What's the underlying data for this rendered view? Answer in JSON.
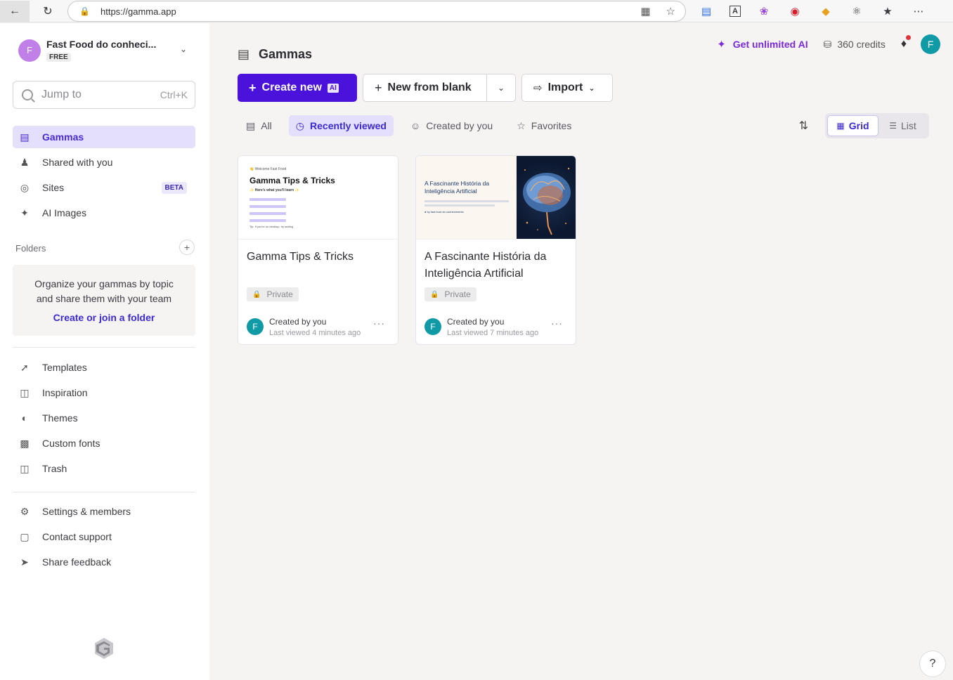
{
  "browser": {
    "url": "https://gamma.app"
  },
  "workspace": {
    "avatar_letter": "F",
    "name": "Fast Food do conheci...",
    "plan": "FREE"
  },
  "search": {
    "placeholder": "Jump to",
    "shortcut": "Ctrl+K"
  },
  "sidebar": {
    "nav": [
      {
        "label": "Gammas",
        "icon": "gammas-icon"
      },
      {
        "label": "Shared with you",
        "icon": "users-icon"
      },
      {
        "label": "Sites",
        "icon": "globe-icon",
        "badge": "BETA"
      },
      {
        "label": "AI Images",
        "icon": "sparkle-icon"
      }
    ],
    "folders_label": "Folders",
    "folders_description": "Organize your gammas by topic and share them with your team",
    "folders_link": "Create or join a folder",
    "secondary_nav": [
      {
        "label": "Templates",
        "icon": "bolt-icon"
      },
      {
        "label": "Inspiration",
        "icon": "book-icon"
      },
      {
        "label": "Themes",
        "icon": "palette-icon"
      },
      {
        "label": "Custom fonts",
        "icon": "font-icon"
      },
      {
        "label": "Trash",
        "icon": "trash-icon"
      }
    ],
    "footer_nav": [
      {
        "label": "Settings & members",
        "icon": "settings-icon"
      },
      {
        "label": "Contact support",
        "icon": "chat-icon"
      },
      {
        "label": "Share feedback",
        "icon": "send-icon"
      }
    ]
  },
  "header": {
    "page_title": "Gammas",
    "unlimited_ai": "Get unlimited AI",
    "credits": "360 credits",
    "user_avatar_letter": "F"
  },
  "actions": {
    "create_new": "Create new",
    "ai_tag": "AI",
    "new_from_blank": "New from blank",
    "import": "Import"
  },
  "filters": [
    {
      "label": "All",
      "icon": "stack-icon"
    },
    {
      "label": "Recently viewed",
      "icon": "clock-icon",
      "active": true
    },
    {
      "label": "Created by you",
      "icon": "user-circle-icon"
    },
    {
      "label": "Favorites",
      "icon": "star-icon"
    }
  ],
  "view": {
    "grid_label": "Grid",
    "list_label": "List"
  },
  "cards": [
    {
      "title": "Gamma Tips & Tricks",
      "visibility": "Private",
      "creator": "Created by you",
      "last_viewed": "Last viewed 4 minutes ago",
      "avatar_letter": "F",
      "thumb": {
        "welcome": "👋 Welcome Fast Food",
        "title": "Gamma Tips & Tricks",
        "subtitle": "✨ Here's what you'll learn ✨",
        "tip": "Tip: If you're on desktop, try adding"
      }
    },
    {
      "title": "A Fascinante História da Inteligência Artificial",
      "visibility": "Private",
      "creator": "Created by you",
      "last_viewed": "Last viewed 7 minutes ago",
      "avatar_letter": "F",
      "thumb": {
        "title": "A Fascinante História da Inteligência Artificial",
        "byline": "● by fast food do conhecimento"
      }
    }
  ],
  "help_label": "?"
}
